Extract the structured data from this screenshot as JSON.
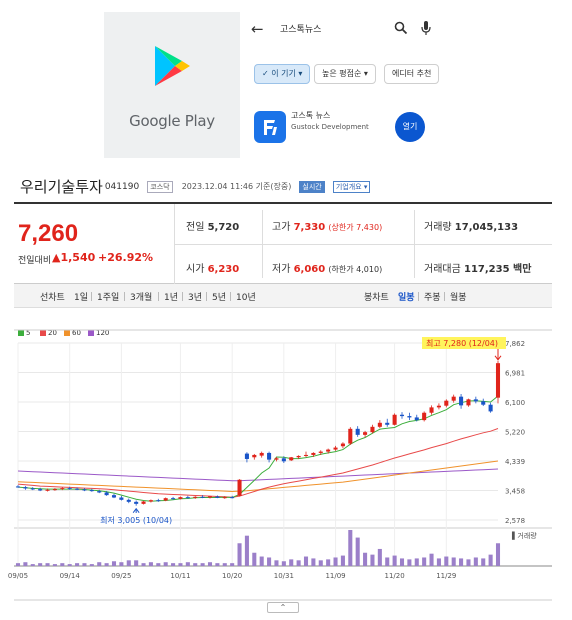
{
  "google_play": {
    "wordmark": "Google Play",
    "search_query": "고스톡뉴스",
    "chips": [
      "이 기기",
      "높은 평점순",
      "에디터 추천"
    ],
    "app_name": "고스톡 뉴스",
    "app_dev": "Gustock Development",
    "install_label": "열기"
  },
  "stock": {
    "name": "우리기술투자",
    "code": "041190",
    "market": "코스닥",
    "date": "2023.12.04 11:46 기준(장중)",
    "live_tag": "실시간",
    "corp_tag": "기업개요",
    "price": "7,260",
    "vs_label": "전일대비",
    "change": "▲1,540",
    "change_pct": "+26.92%",
    "prev_label": "전일",
    "prev_value": "5,720",
    "high_label": "고가",
    "high_value": "7,330",
    "high_limit": "(상한가 7,430)",
    "volume_label": "거래량",
    "volume_value": "17,045,133",
    "open_label": "시가",
    "open_value": "6,230",
    "low_label": "저가",
    "low_value": "6,060",
    "low_limit": "(하한가 4,010)",
    "amount_label": "거래대금",
    "amount_value": "117,235 백만"
  },
  "tabs": {
    "line_label": "선차트",
    "periods": [
      "1일",
      "1주일",
      "3개월",
      "1년",
      "3년",
      "5년",
      "10년"
    ],
    "candle_label": "봉차트",
    "candle_periods": [
      "일봉",
      "주봉",
      "월봉"
    ]
  },
  "chart_data": {
    "type": "line",
    "legend": [
      "5",
      "20",
      "60",
      "120"
    ],
    "colors": {
      "ma5": "#3cae3c",
      "ma20": "#e84a4a",
      "ma60": "#f0922b",
      "ma120": "#9b59c8",
      "up": "#e0241b",
      "down": "#1a55c8"
    },
    "y_ticks": [
      "7,862",
      "6,981",
      "6,100",
      "5,220",
      "4,339",
      "3,458",
      "2,578"
    ],
    "ylim": [
      2578,
      7862
    ],
    "x_ticks": [
      "09/05",
      "09/14",
      "09/25",
      "10/11",
      "10/20",
      "10/31",
      "11/09",
      "11/20",
      "11/29"
    ],
    "x_tick_index": [
      0,
      7,
      14,
      22,
      29,
      36,
      43,
      51,
      58
    ],
    "volume_label": "거래량",
    "max_label": "최고 7,280 (12/04)",
    "min_label": "최저 3,005 (10/04)",
    "candles": [
      [
        3580,
        3620,
        3540,
        3560
      ],
      [
        3560,
        3590,
        3480,
        3520
      ],
      [
        3520,
        3560,
        3470,
        3500
      ],
      [
        3500,
        3540,
        3440,
        3460
      ],
      [
        3460,
        3520,
        3430,
        3480
      ],
      [
        3480,
        3530,
        3450,
        3500
      ],
      [
        3500,
        3560,
        3470,
        3530
      ],
      [
        3530,
        3570,
        3480,
        3510
      ],
      [
        3510,
        3550,
        3470,
        3490
      ],
      [
        3490,
        3530,
        3440,
        3470
      ],
      [
        3470,
        3510,
        3420,
        3440
      ],
      [
        3440,
        3480,
        3380,
        3400
      ],
      [
        3400,
        3440,
        3300,
        3320
      ],
      [
        3320,
        3360,
        3230,
        3250
      ],
      [
        3250,
        3300,
        3160,
        3180
      ],
      [
        3180,
        3220,
        3080,
        3120
      ],
      [
        3120,
        3160,
        3005,
        3060
      ],
      [
        3060,
        3150,
        3040,
        3130
      ],
      [
        3130,
        3190,
        3100,
        3170
      ],
      [
        3170,
        3210,
        3120,
        3160
      ],
      [
        3160,
        3250,
        3140,
        3230
      ],
      [
        3230,
        3270,
        3190,
        3210
      ],
      [
        3210,
        3280,
        3190,
        3260
      ],
      [
        3260,
        3300,
        3220,
        3240
      ],
      [
        3240,
        3290,
        3210,
        3270
      ],
      [
        3270,
        3320,
        3230,
        3250
      ],
      [
        3250,
        3300,
        3220,
        3280
      ],
      [
        3280,
        3310,
        3230,
        3240
      ],
      [
        3240,
        3290,
        3210,
        3260
      ],
      [
        3260,
        3300,
        3220,
        3240
      ],
      [
        3300,
        3800,
        3280,
        3780
      ],
      [
        4560,
        4600,
        4300,
        4400
      ],
      [
        4450,
        4550,
        4380,
        4520
      ],
      [
        4500,
        4620,
        4440,
        4580
      ],
      [
        4580,
        4620,
        4300,
        4380
      ],
      [
        4380,
        4460,
        4330,
        4420
      ],
      [
        4420,
        4480,
        4280,
        4330
      ],
      [
        4360,
        4460,
        4340,
        4450
      ],
      [
        4450,
        4510,
        4400,
        4490
      ],
      [
        4490,
        4620,
        4450,
        4520
      ],
      [
        4520,
        4600,
        4460,
        4580
      ],
      [
        4580,
        4660,
        4520,
        4620
      ],
      [
        4620,
        4710,
        4560,
        4680
      ],
      [
        4680,
        4790,
        4640,
        4740
      ],
      [
        4780,
        4900,
        4720,
        4860
      ],
      [
        4860,
        5350,
        4820,
        5300
      ],
      [
        5300,
        5380,
        5060,
        5120
      ],
      [
        5120,
        5240,
        5050,
        5200
      ],
      [
        5200,
        5420,
        5160,
        5360
      ],
      [
        5360,
        5560,
        5320,
        5480
      ],
      [
        5480,
        5600,
        5360,
        5420
      ],
      [
        5420,
        5760,
        5400,
        5720
      ],
      [
        5720,
        5800,
        5600,
        5680
      ],
      [
        5680,
        5780,
        5560,
        5640
      ],
      [
        5640,
        5720,
        5520,
        5560
      ],
      [
        5560,
        5820,
        5520,
        5780
      ],
      [
        5780,
        6000,
        5720,
        5940
      ],
      [
        5940,
        6060,
        5880,
        5990
      ],
      [
        5990,
        6180,
        5940,
        6140
      ],
      [
        6140,
        6320,
        6080,
        6260
      ],
      [
        6260,
        6340,
        5900,
        6000
      ],
      [
        6000,
        6200,
        5960,
        6180
      ],
      [
        6180,
        6260,
        6060,
        6120
      ],
      [
        6120,
        6200,
        5980,
        6020
      ],
      [
        6020,
        6080,
        5780,
        5820
      ],
      [
        6230,
        7330,
        6060,
        7260
      ]
    ],
    "ma5": [
      3560,
      3540,
      3520,
      3510,
      3500,
      3500,
      3500,
      3500,
      3500,
      3490,
      3470,
      3450,
      3420,
      3380,
      3320,
      3260,
      3200,
      3160,
      3140,
      3150,
      3160,
      3180,
      3210,
      3220,
      3240,
      3250,
      3250,
      3250,
      3260,
      3250,
      3340,
      3550,
      3760,
      3980,
      4130,
      4460,
      4450,
      4410,
      4410,
      4440,
      4480,
      4540,
      4580,
      4620,
      4680,
      4840,
      4960,
      5040,
      5170,
      5290,
      5320,
      5340,
      5450,
      5520,
      5550,
      5600,
      5700,
      5780,
      5870,
      6020,
      6080,
      6130,
      6140,
      6120,
      6100,
      6280
    ],
    "ma20": [
      3650,
      3630,
      3610,
      3590,
      3580,
      3570,
      3560,
      3550,
      3540,
      3530,
      3520,
      3510,
      3500,
      3480,
      3460,
      3440,
      3420,
      3400,
      3380,
      3360,
      3350,
      3340,
      3330,
      3320,
      3310,
      3300,
      3290,
      3280,
      3270,
      3260,
      3290,
      3360,
      3430,
      3500,
      3560,
      3610,
      3660,
      3700,
      3740,
      3780,
      3820,
      3860,
      3900,
      3940,
      3980,
      4040,
      4100,
      4160,
      4220,
      4290,
      4360,
      4430,
      4490,
      4550,
      4610,
      4670,
      4740,
      4800,
      4860,
      4930,
      5000,
      5060,
      5120,
      5180,
      5230,
      5310
    ],
    "ma60": [
      3720,
      3710,
      3700,
      3690,
      3680,
      3670,
      3660,
      3650,
      3640,
      3630,
      3620,
      3610,
      3600,
      3590,
      3580,
      3570,
      3560,
      3550,
      3540,
      3530,
      3520,
      3510,
      3500,
      3490,
      3480,
      3470,
      3460,
      3450,
      3440,
      3430,
      3440,
      3450,
      3470,
      3490,
      3510,
      3530,
      3550,
      3570,
      3590,
      3610,
      3630,
      3650,
      3670,
      3690,
      3710,
      3740,
      3770,
      3800,
      3830,
      3860,
      3890,
      3920,
      3950,
      3980,
      4010,
      4040,
      4070,
      4100,
      4130,
      4160,
      4190,
      4220,
      4250,
      4280,
      4310,
      4340
    ],
    "ma120": [
      4040,
      4030,
      4020,
      4010,
      4000,
      3990,
      3980,
      3970,
      3960,
      3950,
      3940,
      3930,
      3920,
      3910,
      3900,
      3890,
      3880,
      3870,
      3860,
      3850,
      3840,
      3830,
      3820,
      3810,
      3800,
      3790,
      3780,
      3770,
      3760,
      3750,
      3750,
      3760,
      3770,
      3780,
      3790,
      3800,
      3810,
      3820,
      3830,
      3840,
      3850,
      3860,
      3870,
      3880,
      3890,
      3900,
      3910,
      3920,
      3930,
      3940,
      3950,
      3960,
      3970,
      3980,
      3990,
      4000,
      4010,
      4020,
      4030,
      4040,
      4050,
      4060,
      4070,
      4080,
      4090,
      4100
    ],
    "volume": [
      3,
      4,
      2,
      3,
      3,
      2,
      3,
      2,
      3,
      3,
      2,
      4,
      3,
      5,
      4,
      6,
      6,
      3,
      4,
      3,
      4,
      3,
      3,
      4,
      3,
      3,
      4,
      3,
      3,
      3,
      24,
      32,
      14,
      10,
      9,
      6,
      5,
      7,
      6,
      10,
      8,
      6,
      7,
      9,
      11,
      38,
      30,
      14,
      12,
      18,
      9,
      11,
      8,
      7,
      8,
      9,
      13,
      8,
      10,
      9,
      8,
      7,
      9,
      8,
      12,
      24
    ]
  }
}
